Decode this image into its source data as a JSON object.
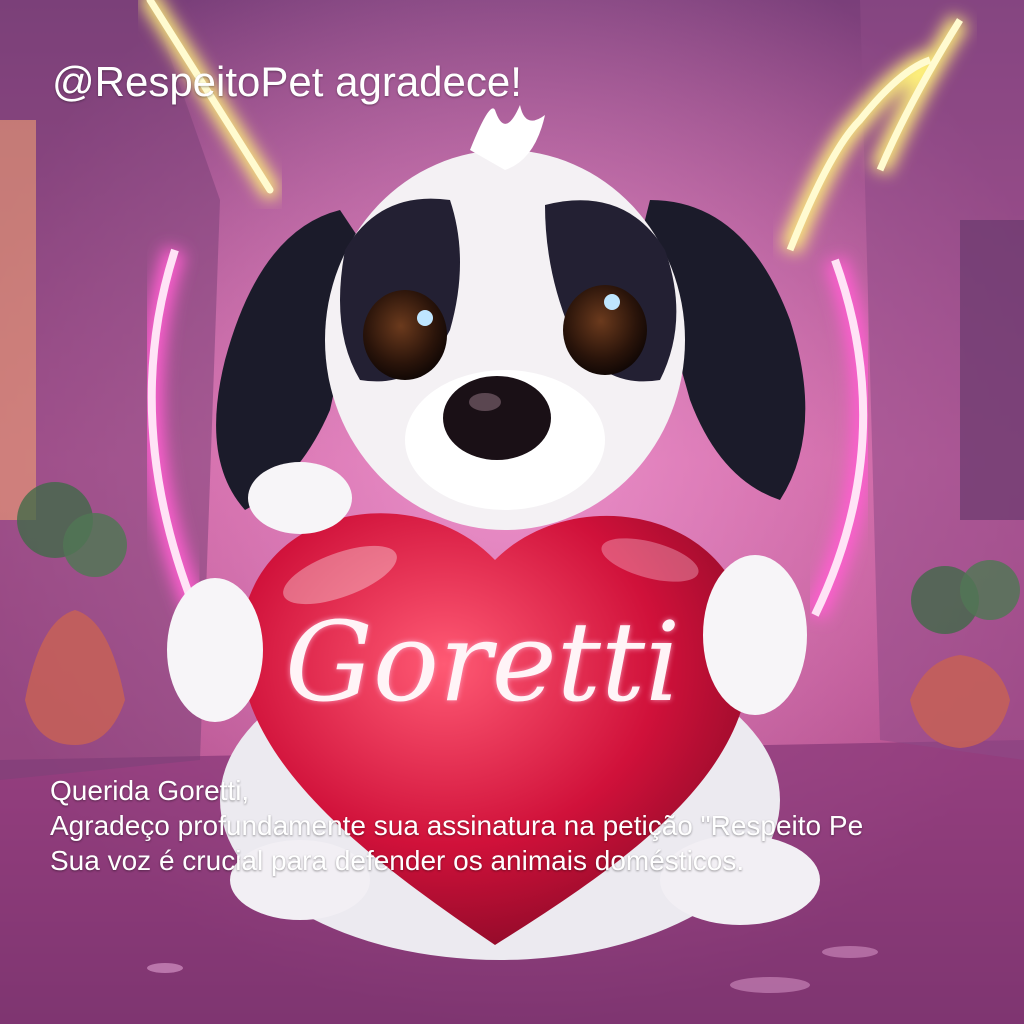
{
  "header": {
    "text": "@RespeitoPet agradece!"
  },
  "heart": {
    "name": "Goretti"
  },
  "message": {
    "line1": "Querida Goretti,",
    "line2": "Agradeço profundamente sua assinatura na petição \"Respeito Pe",
    "line3": "Sua voz é crucial para defender os animais domésticos."
  },
  "colors": {
    "neon_pink": "#ff5fd0",
    "neon_yellow": "#fff27a",
    "heart_red": "#d0113a",
    "wall_pink": "#c45a9a"
  }
}
